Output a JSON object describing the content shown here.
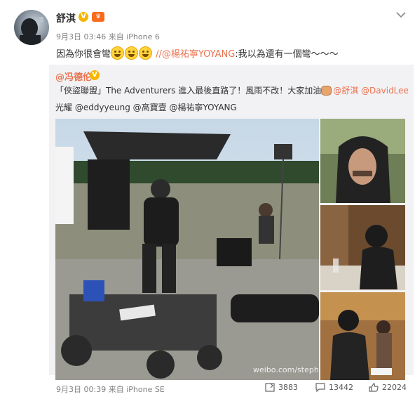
{
  "post": {
    "author": "舒淇",
    "timestamp": "9月3日 03:46",
    "source_prefix": "来自",
    "source": "iPhone 6",
    "text_before_emoji": "因為你很會彎",
    "emoji_count": 3,
    "mention": "//@楊祐寧YOYANG",
    "repost_comment": ":我以為還有一個彎～～～"
  },
  "repost": {
    "author": "@冯德伦",
    "line1_quote": "「俠盜聯盟」The Adventurers 進入最後直路了！風雨不改！大家加油",
    "line1_mentions": "@舒淇 @DavidLee",
    "line2_mentions": "光耀 @eddyyeung @高寶壹 @楊祐寧YOYANG",
    "watermark": "weibo.com/stephe"
  },
  "footer": {
    "timestamp": "9月3日 00:39",
    "source_prefix": "来自",
    "source": "iPhone SE",
    "repost_count": "3883",
    "comment_count": "13442",
    "like_count": "22024"
  },
  "colors": {
    "link": "#eb7350",
    "verified_badge": "#f7b500",
    "repost_bg": "#f2f2f5"
  }
}
